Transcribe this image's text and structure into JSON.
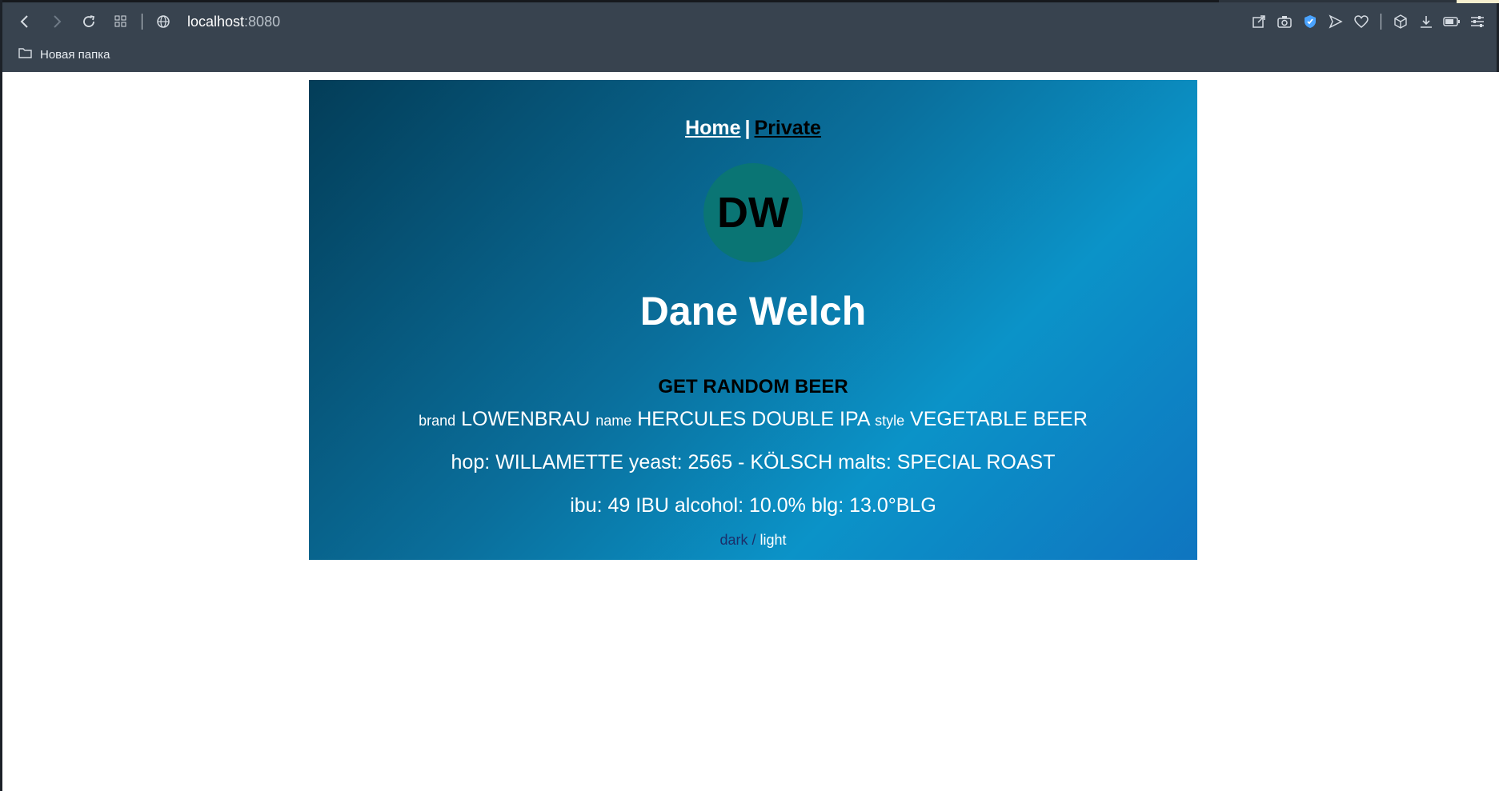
{
  "browser": {
    "url_host": "localhost",
    "url_port": ":8080",
    "bookmark_folder": "Новая папка"
  },
  "nav": {
    "home": "Home",
    "separator": "|",
    "private": "Private"
  },
  "profile": {
    "initials": "DW",
    "name": "Dane Welch"
  },
  "beer": {
    "button": "GET RANDOM BEER",
    "brand_label": "brand",
    "brand": "LOWENBRAU",
    "name_label": "name",
    "name": "HERCULES DOUBLE IPA",
    "style_label": "style",
    "style": "VEGETABLE BEER",
    "hop_label": "hop:",
    "hop": "WILLAMETTE",
    "yeast_label": "yeast:",
    "yeast": "2565 - KÖLSCH",
    "malts_label": "malts:",
    "malts": "SPECIAL ROAST",
    "ibu_label": "ibu:",
    "ibu": "49 IBU",
    "alcohol_label": "alcohol:",
    "alcohol": "10.0%",
    "blg_label": "blg:",
    "blg": "13.0°BLG"
  },
  "theme": {
    "dark": "dark",
    "slash": "/",
    "light": "light"
  },
  "colors": {
    "chrome_bg": "#38434f",
    "card_gradient_start": "#033d58",
    "card_gradient_end": "#0f75c0",
    "avatar_bg": "#0a7574"
  }
}
